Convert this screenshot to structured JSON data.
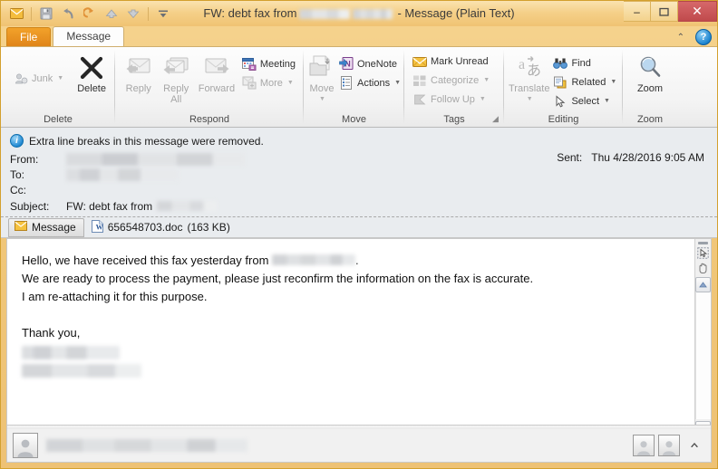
{
  "window": {
    "title_prefix": "FW: debt fax from",
    "title_suffix": "- Message (Plain Text)",
    "minimize_label": "–",
    "maximize_label": "❐",
    "close_label": "✕"
  },
  "quick_access": {
    "items": [
      {
        "name": "envelope-icon",
        "tooltip": "Outlook Item"
      },
      {
        "name": "save-icon",
        "tooltip": "Save"
      },
      {
        "name": "undo-icon",
        "tooltip": "Undo"
      },
      {
        "name": "redo-icon",
        "tooltip": "Redo"
      },
      {
        "name": "previous-item-icon",
        "tooltip": "Previous Item"
      },
      {
        "name": "next-item-icon",
        "tooltip": "Next Item"
      },
      {
        "name": "customize-qat-icon",
        "tooltip": "Customize Quick Access Toolbar"
      }
    ]
  },
  "tabs": {
    "file": "File",
    "message": "Message",
    "collapse_ribbon_label": "⌃",
    "help_label": "?"
  },
  "ribbon": {
    "groups": [
      {
        "label": "Delete",
        "small_items": [
          {
            "label": "Junk",
            "has_caret": true,
            "disabled": true
          }
        ],
        "big_items": [
          {
            "label": "Delete",
            "disabled": false
          }
        ]
      },
      {
        "label": "Respond",
        "big_items": [
          {
            "label": "Reply",
            "disabled": true
          },
          {
            "label": "Reply All",
            "disabled": true
          },
          {
            "label": "Forward",
            "disabled": true
          }
        ],
        "small_items": [
          {
            "label": "Meeting",
            "has_caret": false,
            "disabled": false
          },
          {
            "label": "More",
            "has_caret": true,
            "disabled": true
          }
        ]
      },
      {
        "label": "Move",
        "big_items": [
          {
            "label": "Move",
            "disabled": true,
            "has_caret": true
          }
        ],
        "small_items": [
          {
            "label": "OneNote",
            "has_caret": false,
            "disabled": false
          },
          {
            "label": "Actions",
            "has_caret": true,
            "disabled": false
          }
        ]
      },
      {
        "label": "Tags",
        "has_dialog_launcher": true,
        "small_items": [
          {
            "label": "Mark Unread",
            "has_caret": false,
            "disabled": false
          },
          {
            "label": "Categorize",
            "has_caret": true,
            "disabled": true
          },
          {
            "label": "Follow Up",
            "has_caret": true,
            "disabled": true
          }
        ]
      },
      {
        "label": "Editing",
        "big_items": [
          {
            "label": "Translate",
            "disabled": true,
            "has_caret": true
          }
        ],
        "small_items": [
          {
            "label": "Find",
            "has_caret": false,
            "disabled": false
          },
          {
            "label": "Related",
            "has_caret": true,
            "disabled": false
          },
          {
            "label": "Select",
            "has_caret": true,
            "disabled": false
          }
        ]
      },
      {
        "label": "Zoom",
        "big_items": [
          {
            "label": "Zoom",
            "disabled": false
          }
        ]
      }
    ]
  },
  "header": {
    "info_bar": "Extra line breaks in this message were removed.",
    "fields": [
      {
        "label": "From:",
        "value": "",
        "redacted": true
      },
      {
        "label": "To:",
        "value": "",
        "redacted": true
      },
      {
        "label": "Cc:",
        "value": "",
        "redacted": false
      },
      {
        "label": "Subject:",
        "value": "FW: debt fax from",
        "redacted": true
      }
    ],
    "sent_label": "Sent:",
    "sent_value": "Thu 4/28/2016 9:05 AM"
  },
  "attachments": {
    "message_tab_label": "Message",
    "items": [
      {
        "filename": "656548703.doc",
        "size": "(163 KB)",
        "icon": "word-doc-icon"
      }
    ]
  },
  "body": {
    "lines": [
      {
        "type": "text",
        "before": "Hello, we have received this fax yesterday from ",
        "redacted": true,
        "after": "."
      },
      {
        "type": "text",
        "before": "We are ready to process the payment, please just reconfirm the information on the fax is accurate.",
        "redacted": false,
        "after": ""
      },
      {
        "type": "text",
        "before": "I am re-attaching it for this purpose.",
        "redacted": false,
        "after": ""
      },
      {
        "type": "blank"
      },
      {
        "type": "text",
        "before": "Thank you,",
        "redacted": false,
        "after": ""
      },
      {
        "type": "redacted-block"
      },
      {
        "type": "redacted-block"
      }
    ]
  },
  "scrollbar": {
    "select-tool": "select-object-icon",
    "hand-tool": "hand-pan-icon",
    "up_arrow": "▲",
    "down_arrow": "▼"
  },
  "people_pane": {
    "contact_name": "",
    "redacted": true,
    "expand_label": "▲"
  },
  "colors": {
    "accent": "#f2a22a",
    "titlebar": "#f5d089",
    "close_button": "#c04a4c",
    "body_bg": "#ffffff",
    "header_bg": "#e9ecef"
  }
}
